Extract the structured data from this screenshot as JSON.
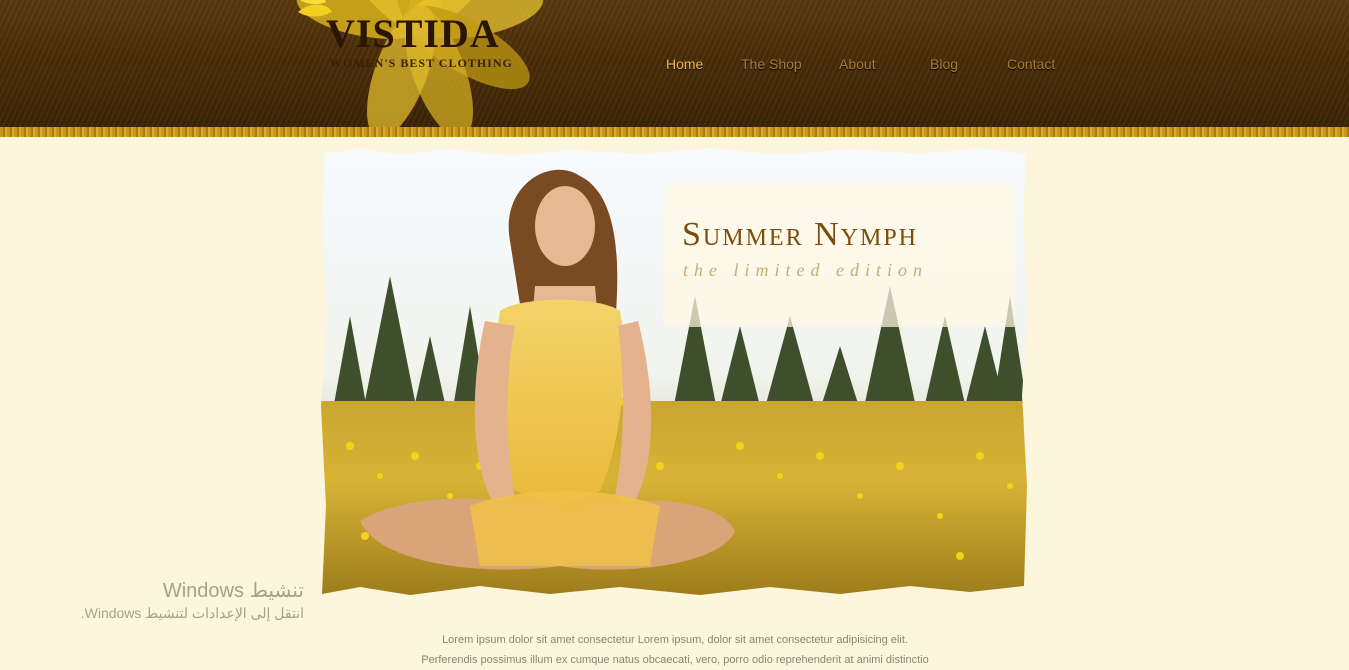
{
  "brand": {
    "name": "VISTIDA",
    "tagline": "WOMEN'S BEST CLOTHING"
  },
  "nav": {
    "items": [
      {
        "label": "Home",
        "active": true
      },
      {
        "label": "The Shop",
        "active": false
      },
      {
        "label": "About",
        "active": false
      },
      {
        "label": "Blog",
        "active": false
      },
      {
        "label": "Contact",
        "active": false
      }
    ]
  },
  "hero": {
    "title": "Summer Nymph",
    "subtitle": "the limited edition"
  },
  "content": {
    "line1": "Lorem ipsum dolor sit amet consectetur Lorem ipsum, dolor sit amet consectetur adipisicing elit.",
    "line2": "Perferendis possimus illum ex cumque natus obcaecati, vero, porro odio reprehenderit at animi distinctio"
  },
  "windows_activation": {
    "title": "تنشيط Windows",
    "message": "انتقل إلى الإعدادات لتنشيط Windows."
  },
  "colors": {
    "header": "#4a2d08",
    "accent": "#f2b654",
    "page_background": "#fdf6dc"
  }
}
